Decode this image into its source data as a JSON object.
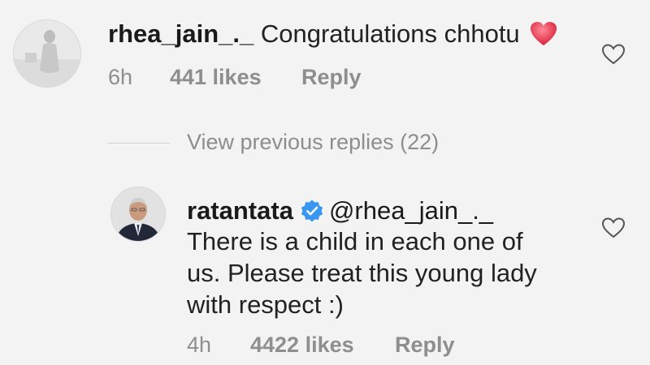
{
  "comment1": {
    "username": "rhea_jain_._",
    "text": "Congratulations chhotu",
    "emoji": "heart-emoji",
    "time": "6h",
    "likes": "441 likes",
    "reply_label": "Reply"
  },
  "view_previous": {
    "label": "View previous replies (22)"
  },
  "comment2": {
    "username": "ratantata",
    "verified_icon": "verified-badge-icon",
    "mention": "@rhea_jain_._",
    "lines": [
      "There is a child in each one of",
      "us. Please treat this young lady",
      "with respect :)"
    ],
    "time": "4h",
    "likes": "4422 likes",
    "reply_label": "Reply"
  },
  "colors": {
    "background": "#f3f3f3",
    "text": "#222222",
    "meta": "#8e8e8e",
    "verified": "#3897f0",
    "heart_emoji": "#e8334a"
  }
}
